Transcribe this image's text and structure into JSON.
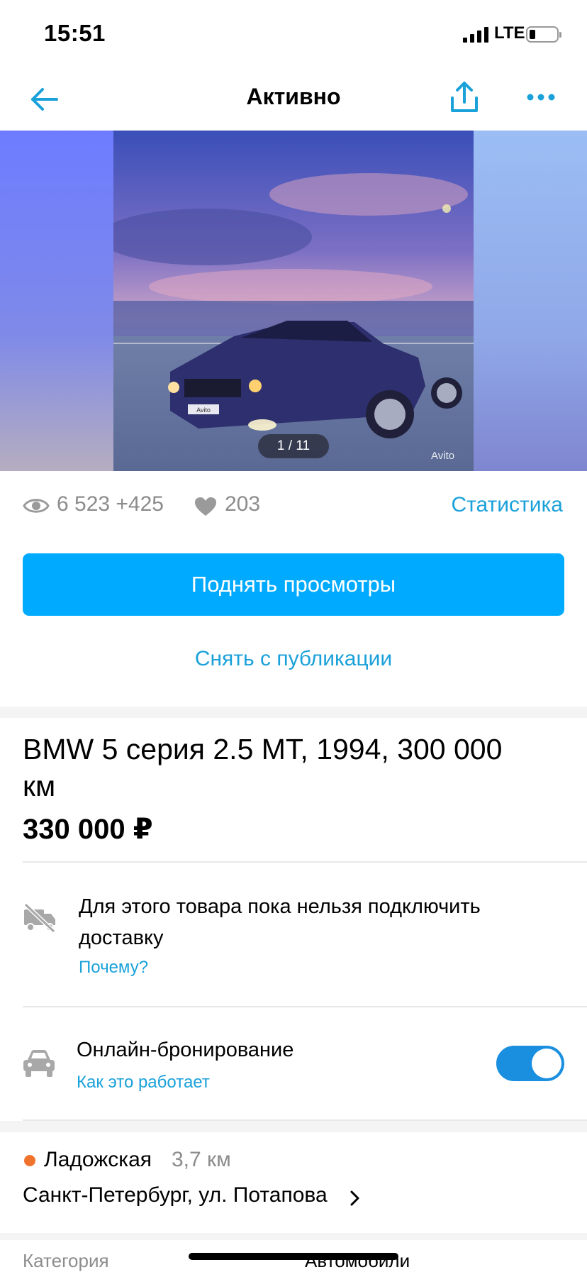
{
  "status_bar": {
    "time": "15:51",
    "network": "LTE"
  },
  "nav": {
    "title": "Активно",
    "back_icon": "arrow-left-icon",
    "share_icon": "share-icon",
    "more_icon": "more-dots-icon"
  },
  "gallery": {
    "counter": "1 / 11",
    "watermark": "Avito",
    "plate_text": "Avito"
  },
  "stats": {
    "views": "6 523 +425",
    "likes": "203",
    "stats_link": "Статистика"
  },
  "actions": {
    "raise_views": "Поднять просмотры",
    "unpublish": "Снять с публикации"
  },
  "listing": {
    "title": "BMW 5 серия 2.5 MT, 1994, 300 000 км",
    "price": "330 000 ₽"
  },
  "delivery": {
    "text": "Для этого товара пока нельзя подключить доставку",
    "why_link": "Почему?"
  },
  "booking": {
    "title": "Онлайн-бронирование",
    "link": "Как это работает",
    "enabled": true
  },
  "location": {
    "metro": "Ладожская",
    "metro_distance": "3,7 км",
    "address": "Санкт-Петербург, ул. Потапова",
    "metro_color": "#f0732d"
  },
  "params": {
    "category_label": "Категория",
    "category_value": "Автомобили"
  },
  "colors": {
    "accent": "#00aaff",
    "link": "#1aa1d9"
  }
}
